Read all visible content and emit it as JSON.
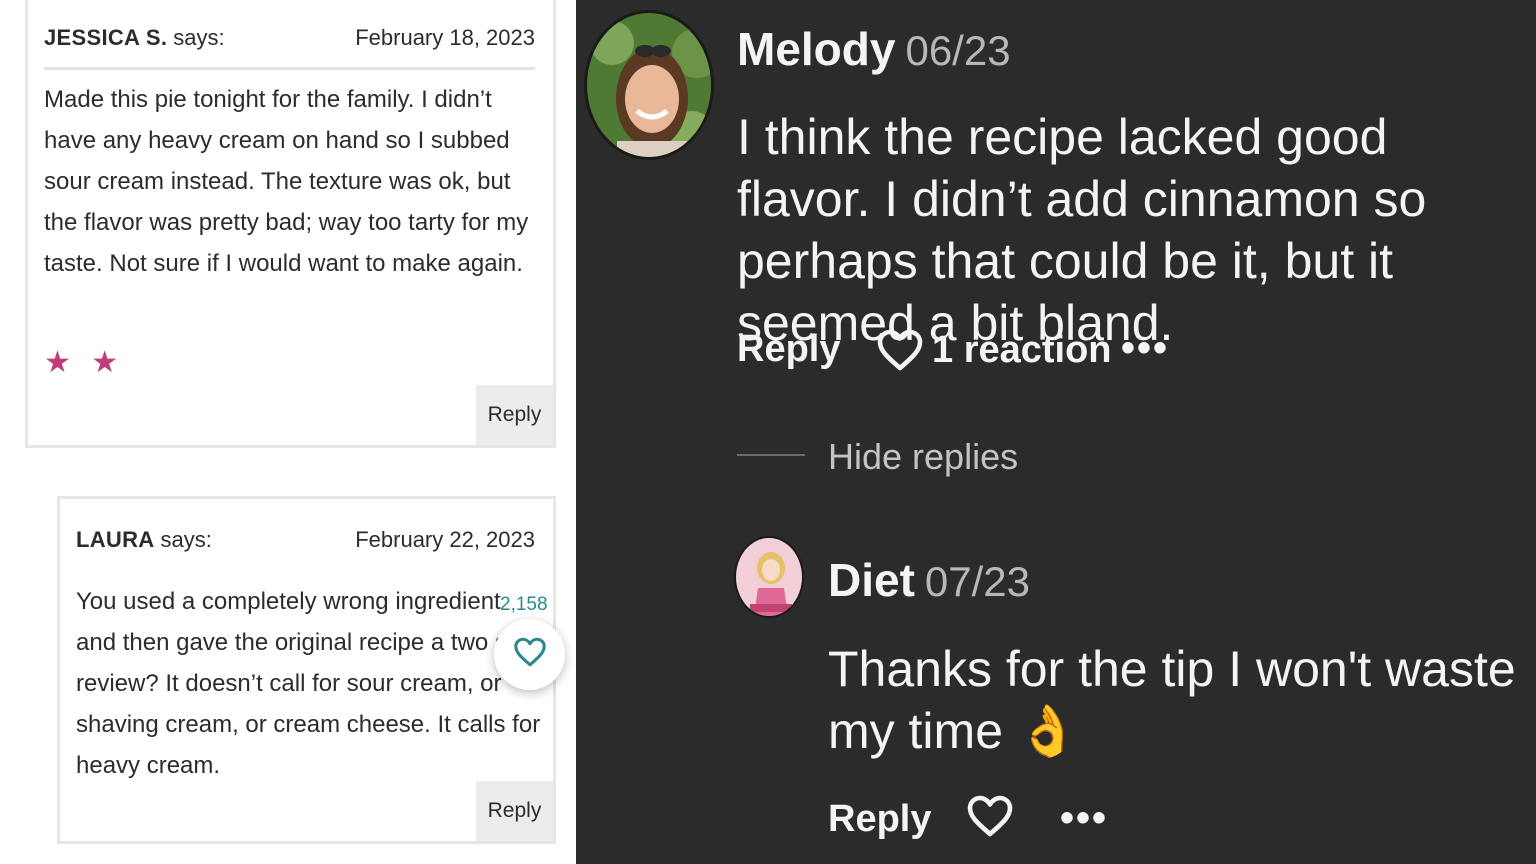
{
  "left_panel": {
    "comment1": {
      "author": "JESSICA S.",
      "says": "says:",
      "date": "February 18, 2023",
      "body": "Made this pie tonight for the family. I didn’t have any heavy cream on hand so I subbed sour cream instead. The texture was ok, but the flavor was pretty bad; way too tarty for my taste. Not sure if I would want to make again.",
      "stars": "★ ★",
      "rating": 2,
      "reply_label": "Reply"
    },
    "comment2": {
      "author": "LAURA",
      "says": "says:",
      "date": "February 22, 2023",
      "body": "You used a completely wrong ingredient and then gave the original recipe a two star review? It doesn’t call for sour cream, or shaving cream, or cream cheese. It calls for heavy cream.",
      "reply_label": "Reply"
    },
    "favorites": {
      "count": "2,158",
      "icon": "heart-outline-icon",
      "color": "#2a8a8a"
    },
    "star_color": "#c13b79"
  },
  "right_panel": {
    "comment": {
      "author": "Melody",
      "date": "06/23",
      "body": "I think the recipe lacked good flavor. I didn’t add cinnamon so perhaps that could be it, but it seemed a bit bland.",
      "reply_label": "Reply",
      "reactions_label": "1 reaction",
      "more": "•••"
    },
    "hide_replies_label": "Hide replies",
    "reply": {
      "author": "Diet",
      "date": "07/23",
      "body": "Thanks for the tip I won't waste my time 👌",
      "reply_label": "Reply",
      "more": "•••"
    },
    "background": "#2b2b2b"
  }
}
